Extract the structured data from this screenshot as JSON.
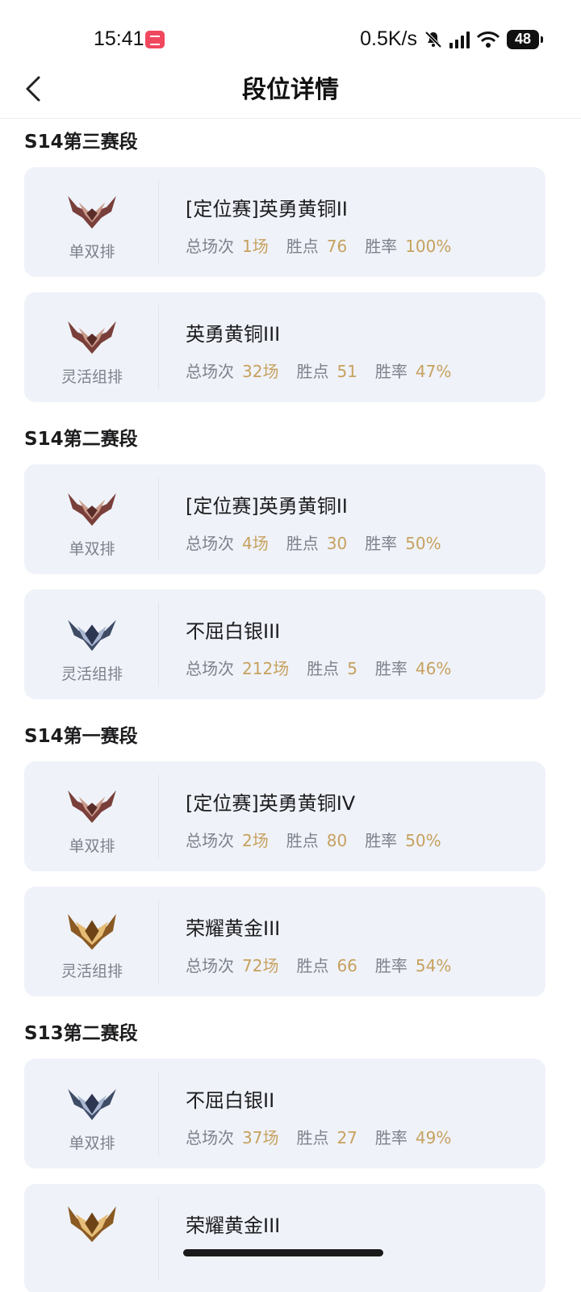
{
  "status": {
    "time": "15:41",
    "net_speed": "0.5K/s",
    "battery": "48"
  },
  "header": {
    "title": "段位详情"
  },
  "labels": {
    "games": "总场次",
    "lp": "胜点",
    "winrate": "胜率"
  },
  "colors": {
    "accent": "#c7a15e",
    "card_bg": "#eff2f9",
    "bronze": "#9b5e56",
    "silver": "#5b6a8a",
    "gold": "#b07d3c"
  },
  "seasons": [
    {
      "title": "S14第三赛段",
      "entries": [
        {
          "queue": "单双排",
          "rank": "[定位赛]英勇黄铜II",
          "games": "1场",
          "lp": "76",
          "winrate": "100%",
          "emblem": "bronze"
        },
        {
          "queue": "灵活组排",
          "rank": "英勇黄铜III",
          "games": "32场",
          "lp": "51",
          "winrate": "47%",
          "emblem": "bronze"
        }
      ]
    },
    {
      "title": "S14第二赛段",
      "entries": [
        {
          "queue": "单双排",
          "rank": "[定位赛]英勇黄铜II",
          "games": "4场",
          "lp": "30",
          "winrate": "50%",
          "emblem": "bronze"
        },
        {
          "queue": "灵活组排",
          "rank": "不屈白银III",
          "games": "212场",
          "lp": "5",
          "winrate": "46%",
          "emblem": "silver"
        }
      ]
    },
    {
      "title": "S14第一赛段",
      "entries": [
        {
          "queue": "单双排",
          "rank": "[定位赛]英勇黄铜IV",
          "games": "2场",
          "lp": "80",
          "winrate": "50%",
          "emblem": "bronze"
        },
        {
          "queue": "灵活组排",
          "rank": "荣耀黄金III",
          "games": "72场",
          "lp": "66",
          "winrate": "54%",
          "emblem": "gold"
        }
      ]
    },
    {
      "title": "S13第二赛段",
      "entries": [
        {
          "queue": "单双排",
          "rank": "不屈白银II",
          "games": "37场",
          "lp": "27",
          "winrate": "49%",
          "emblem": "silver"
        },
        {
          "queue": "",
          "rank": "荣耀黄金III",
          "games": "",
          "lp": "",
          "winrate": "",
          "emblem": "gold"
        }
      ]
    }
  ]
}
